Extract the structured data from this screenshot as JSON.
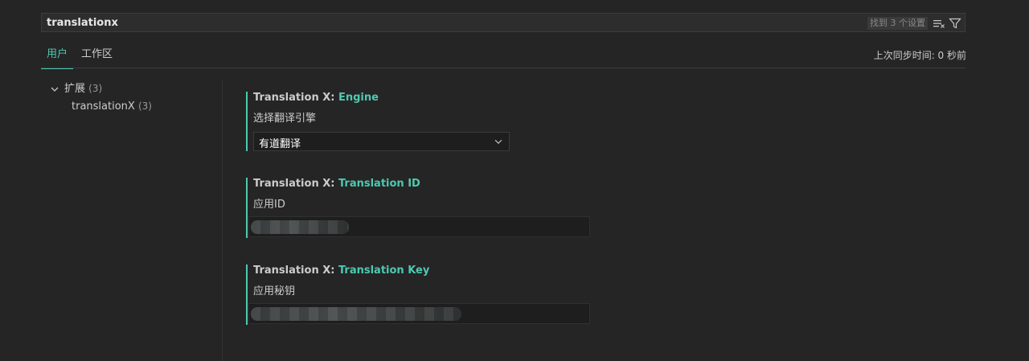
{
  "search": {
    "value": "translationx",
    "result_count": "找到 3 个设置",
    "icons": [
      "clear-filter-icon",
      "filter-icon"
    ]
  },
  "tabs": [
    {
      "label": "用户",
      "active": true
    },
    {
      "label": "工作区",
      "active": false
    }
  ],
  "sync_status": "上次同步时间: 0 秒前",
  "toc": {
    "group_label": "扩展",
    "group_count": "(3)",
    "item_label": "translationX",
    "item_count": "(3)"
  },
  "settings": [
    {
      "category": "Translation X: ",
      "key": "Engine",
      "description": "选择翻译引擎",
      "type": "select",
      "value": "有道翻译"
    },
    {
      "category": "Translation X: ",
      "key": "Translation ID",
      "description": "应用ID",
      "type": "text",
      "value_obscured": true
    },
    {
      "category": "Translation X: ",
      "key": "Translation Key",
      "description": "应用秘钥",
      "type": "text",
      "value_obscured": true
    }
  ],
  "colors": {
    "background": "#252526",
    "accent": "#4ec9b0",
    "text": "#cccccc",
    "input_background": "#1e1e1e"
  }
}
